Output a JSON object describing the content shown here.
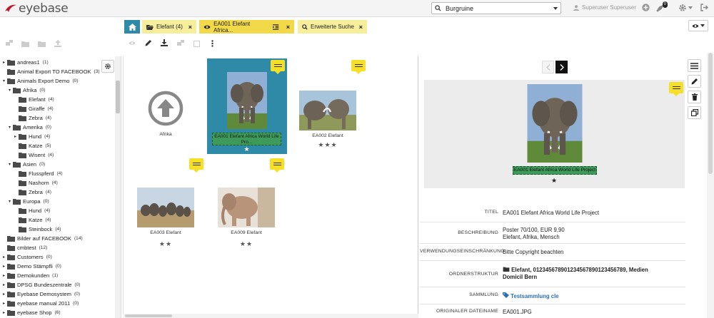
{
  "app": {
    "logo_text": "eyebase"
  },
  "search": {
    "value": "Burgruine"
  },
  "user": {
    "name": "Superuser Superuser",
    "notifications": "0"
  },
  "tabs": [
    {
      "label": "Elefant (4)"
    },
    {
      "label": "EA001 Elefant Africa..."
    },
    {
      "label": "Erweiterte Suche"
    }
  ],
  "tab_close": "×",
  "tree": [
    {
      "label": "andreas1",
      "count": "(1)",
      "level": 0,
      "toggle": "▸"
    },
    {
      "label": "Animal Export TO FACEBOOK",
      "count": "(3)",
      "level": 0,
      "toggle": ""
    },
    {
      "label": "Animals Export Demo",
      "count": "(0)",
      "level": 0,
      "toggle": "▾"
    },
    {
      "label": "Afrika",
      "count": "(0)",
      "level": 1,
      "toggle": "▾"
    },
    {
      "label": "Elefant",
      "count": "(4)",
      "level": 2,
      "toggle": ""
    },
    {
      "label": "Giraffe",
      "count": "(4)",
      "level": 2,
      "toggle": ""
    },
    {
      "label": "Zebra",
      "count": "(4)",
      "level": 2,
      "toggle": ""
    },
    {
      "label": "Amerika",
      "count": "(0)",
      "level": 1,
      "toggle": "▾"
    },
    {
      "label": "Hund",
      "count": "(4)",
      "level": 2,
      "toggle": "▸"
    },
    {
      "label": "Katze",
      "count": "(5)",
      "level": 2,
      "toggle": ""
    },
    {
      "label": "Wisent",
      "count": "(4)",
      "level": 2,
      "toggle": ""
    },
    {
      "label": "Asien",
      "count": "(0)",
      "level": 1,
      "toggle": "▾"
    },
    {
      "label": "Flusspferd",
      "count": "(4)",
      "level": 2,
      "toggle": ""
    },
    {
      "label": "Nashorn",
      "count": "(4)",
      "level": 2,
      "toggle": ""
    },
    {
      "label": "Zebra",
      "count": "(4)",
      "level": 2,
      "toggle": ""
    },
    {
      "label": "Europa",
      "count": "(0)",
      "level": 1,
      "toggle": "▾"
    },
    {
      "label": "Hund",
      "count": "(4)",
      "level": 2,
      "toggle": ""
    },
    {
      "label": "Katze",
      "count": "(4)",
      "level": 2,
      "toggle": ""
    },
    {
      "label": "Steinbock",
      "count": "(4)",
      "level": 2,
      "toggle": ""
    },
    {
      "label": "Bilder auf FACEBOOK",
      "count": "(14)",
      "level": 0,
      "toggle": ""
    },
    {
      "label": "cmbtest",
      "count": "(12)",
      "level": 0,
      "toggle": ""
    },
    {
      "label": "Customers",
      "count": "(0)",
      "level": 0,
      "toggle": "▸"
    },
    {
      "label": "Demo Stämpfli",
      "count": "(0)",
      "level": 0,
      "toggle": "▸"
    },
    {
      "label": "Demokunden",
      "count": "(1)",
      "level": 0,
      "toggle": "▸"
    },
    {
      "label": "DPSG Bundeszentrale",
      "count": "(0)",
      "level": 0,
      "toggle": "▸"
    },
    {
      "label": "Eyebase Demosystem",
      "count": "(0)",
      "level": 0,
      "toggle": "▸"
    },
    {
      "label": "eyebase manual 2011",
      "count": "(0)",
      "level": 0,
      "toggle": "▸"
    },
    {
      "label": "eyebase Shop",
      "count": "(6)",
      "level": 0,
      "toggle": "▸"
    }
  ],
  "grid": {
    "folder_up_label": "Afrika",
    "items": [
      {
        "caption": "EA001 Elefant Africa World Life Pro...",
        "stars": "★"
      },
      {
        "caption": "EA002 Elefant",
        "stars": "★★★"
      },
      {
        "caption": "EA003 Elefant",
        "stars": "★★"
      },
      {
        "caption": "EA009 Elefant",
        "stars": "★★"
      }
    ]
  },
  "detail": {
    "preview_caption": "EA001 Elefant Africa World Life Project",
    "preview_stars": "★",
    "meta": [
      {
        "key": "TITEL",
        "value": "EA001 Elefant Africa World Life Project"
      },
      {
        "key": "BESCHREIBUNG",
        "value": "Poster 70/100, EUR 9,90",
        "value2": "Elefant, Afrika, Mensch"
      },
      {
        "key": "VERWENDUNGSEINSCHRÄNKUNG",
        "value": "Bitte Copyright beachten"
      },
      {
        "key": "ORDNERSTRUKTUR",
        "value": "Elefant, 0123456789012345678901234567​89, Medien",
        "value2": "Domicil Bern"
      },
      {
        "key": "SAMMLUNG",
        "value": "Testsammlung cle"
      },
      {
        "key": "ORIGINALER DATEINAME",
        "value": "EA001.JPG"
      }
    ]
  }
}
